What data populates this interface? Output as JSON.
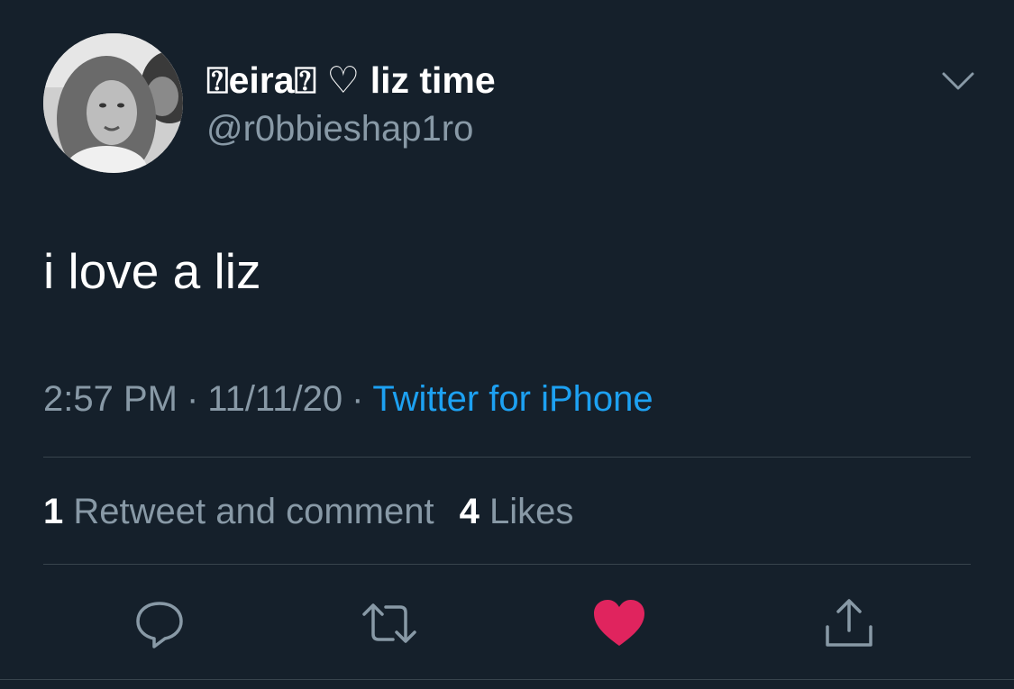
{
  "tweet": {
    "display_name": "⍰eira⍰ ♡ liz time",
    "handle": "@r0bbieshap1ro",
    "text": "i love a liz",
    "time": "2:57 PM",
    "date": "11/11/20",
    "separator": "·",
    "source": "Twitter for iPhone"
  },
  "stats": {
    "retweet_count": "1",
    "retweet_label": "Retweet and comment",
    "like_count": "4",
    "like_label": "Likes"
  },
  "actions": {
    "reply_icon": "reply-bubble-icon",
    "retweet_icon": "retweet-arrows-icon",
    "like_icon": "heart-filled-icon",
    "share_icon": "share-upload-icon",
    "like_active": true
  },
  "colors": {
    "background": "#15202b",
    "secondary_text": "#8899a6",
    "link": "#1da1f2",
    "liked": "#e0245e",
    "divider": "#38444d"
  }
}
